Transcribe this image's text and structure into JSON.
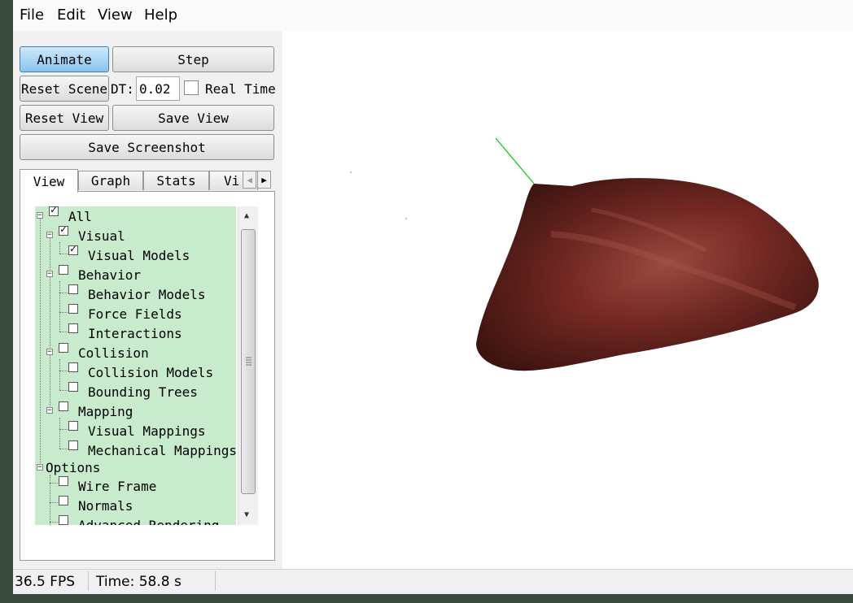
{
  "menubar": {
    "items": [
      "File",
      "Edit",
      "View",
      "Help"
    ]
  },
  "controls": {
    "animate_label": "Animate",
    "step_label": "Step",
    "reset_scene_label": "Reset Scene",
    "dt_label": "DT:",
    "dt_value": "0.02",
    "real_time_label": "Real Time",
    "real_time_checked": false,
    "reset_view_label": "Reset View",
    "save_view_label": "Save View",
    "save_screenshot_label": "Save Screenshot"
  },
  "tabs": [
    "View",
    "Graph",
    "Stats",
    "Vi"
  ],
  "active_tab": "View",
  "tree": {
    "all": {
      "label": "All",
      "checked": true
    },
    "visual": {
      "label": "Visual",
      "checked": true
    },
    "visual_models": {
      "label": "Visual Models",
      "checked": true
    },
    "behavior": {
      "label": "Behavior",
      "checked": false
    },
    "behavior_models": {
      "label": "Behavior Models",
      "checked": false
    },
    "force_fields": {
      "label": "Force Fields",
      "checked": false
    },
    "interactions": {
      "label": "Interactions",
      "checked": false
    },
    "collision": {
      "label": "Collision",
      "checked": false
    },
    "collision_models": {
      "label": "Collision Models",
      "checked": false
    },
    "bounding_trees": {
      "label": "Bounding Trees",
      "checked": false
    },
    "mapping": {
      "label": "Mapping",
      "checked": false
    },
    "visual_mappings": {
      "label": "Visual Mappings",
      "checked": false
    },
    "mechanical_mappings": {
      "label": "Mechanical Mappings",
      "checked": false
    },
    "options": {
      "label": "Options"
    },
    "wire_frame": {
      "label": "Wire Frame",
      "checked": false
    },
    "normals": {
      "label": "Normals",
      "checked": false
    },
    "advanced_rendering": {
      "label": "Advanced Rendering",
      "checked": false
    }
  },
  "status": {
    "fps": "36.5 FPS",
    "time": "Time: 58.8 s"
  },
  "colors": {
    "tree_background": "#c9ebcd",
    "active_button": "#88c4ee",
    "organ_tissue": "#7a2a24",
    "axis_line": "#00cc00"
  }
}
